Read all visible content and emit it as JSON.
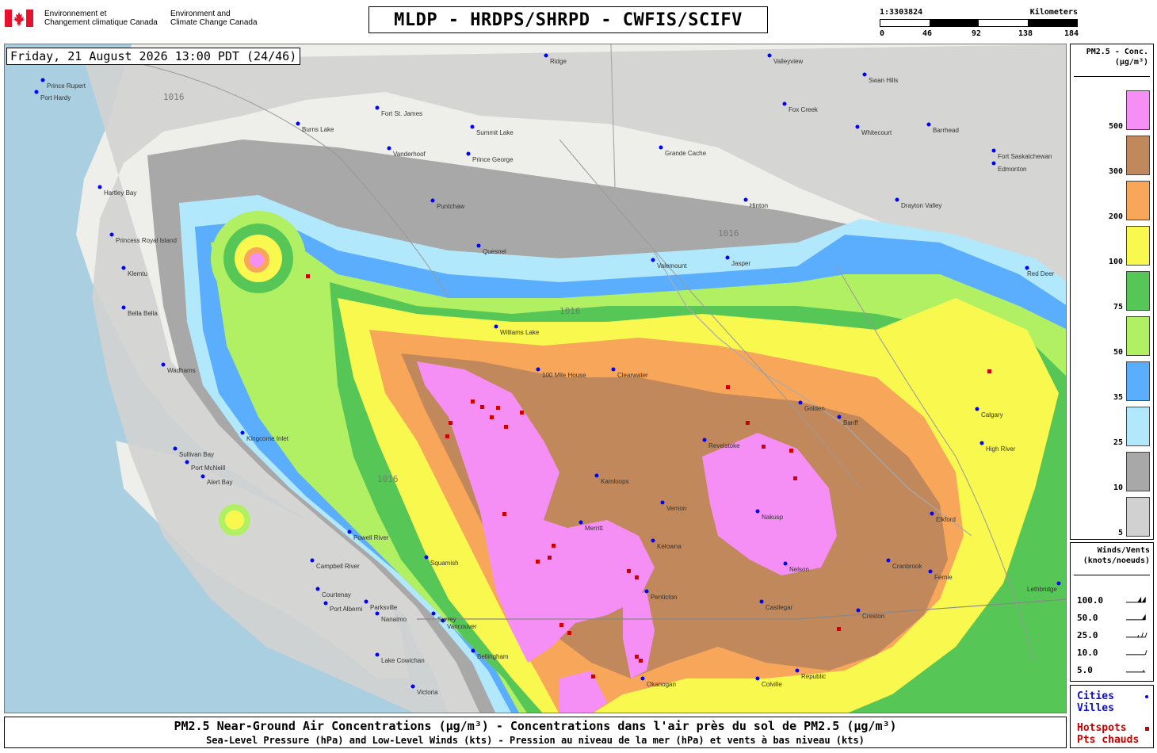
{
  "header": {
    "gov_fr": "Environnement et\nChangement climatique Canada",
    "gov_en": "Environment and\nClimate Change Canada",
    "title": "MLDP - HRDPS/SHRPD - CWFIS/SCIFV",
    "scale_ratio": "1:3303824",
    "scale_unit": "Kilometers",
    "scale_ticks": [
      "0",
      "46",
      "92",
      "138",
      "184"
    ]
  },
  "map": {
    "timestamp": "Friday, 21 August 2026 13:00 PDT (24/46)",
    "isobar_label": "1016",
    "cities": [
      {
        "name": "Ridge"
      },
      {
        "name": "Valleyview"
      },
      {
        "name": "Swan Hills"
      },
      {
        "name": "Fox Creek"
      },
      {
        "name": "Port Hardy"
      },
      {
        "name": "Prince Rupert"
      },
      {
        "name": "Fort St. James"
      },
      {
        "name": "Summit Lake"
      },
      {
        "name": "Burns Lake"
      },
      {
        "name": "Vanderhoof"
      },
      {
        "name": "Prince George"
      },
      {
        "name": "Grande Cache"
      },
      {
        "name": "Whitecourt"
      },
      {
        "name": "Barrhead"
      },
      {
        "name": "Fort Saskatchewan"
      },
      {
        "name": "Edmonton"
      },
      {
        "name": "Hartley Bay"
      },
      {
        "name": "Princess Royal Island"
      },
      {
        "name": "Klemtu"
      },
      {
        "name": "Bella Bella"
      },
      {
        "name": "Puntchaw"
      },
      {
        "name": "Quesnel"
      },
      {
        "name": "Hinton"
      },
      {
        "name": "Drayton Valley"
      },
      {
        "name": "Valemount"
      },
      {
        "name": "Jasper"
      },
      {
        "name": "Williams Lake"
      },
      {
        "name": "100 Mile House"
      },
      {
        "name": "Clearwater"
      },
      {
        "name": "Revelstoke"
      },
      {
        "name": "Golden"
      },
      {
        "name": "Banff"
      },
      {
        "name": "Calgary"
      },
      {
        "name": "High River"
      },
      {
        "name": "Kamloops"
      },
      {
        "name": "Vernon"
      },
      {
        "name": "Kelowna"
      },
      {
        "name": "Penticton"
      },
      {
        "name": "Merritt"
      },
      {
        "name": "Nakusp"
      },
      {
        "name": "Nelson"
      },
      {
        "name": "Castlegar"
      },
      {
        "name": "Cranbrook"
      },
      {
        "name": "Fernie"
      },
      {
        "name": "Elkford"
      },
      {
        "name": "Creston"
      },
      {
        "name": "Port McNeill"
      },
      {
        "name": "Campbell River"
      },
      {
        "name": "Powell River"
      },
      {
        "name": "Courtenay"
      },
      {
        "name": "Squamish"
      },
      {
        "name": "Port Alberni"
      },
      {
        "name": "Parksville"
      },
      {
        "name": "Nanaimo"
      },
      {
        "name": "Vancouver"
      },
      {
        "name": "Surrey"
      },
      {
        "name": "Lake Cowichan"
      },
      {
        "name": "Victoria"
      },
      {
        "name": "Bellingham"
      },
      {
        "name": "Wadhams"
      },
      {
        "name": "Sullivan Bay"
      },
      {
        "name": "Kingcome Inlet"
      },
      {
        "name": "Alert Bay"
      },
      {
        "name": "Red Deer"
      },
      {
        "name": "Lethbridge"
      },
      {
        "name": "Okanogan"
      },
      {
        "name": "Republic"
      },
      {
        "name": "Colville"
      }
    ]
  },
  "legend": {
    "title": "PM2.5 - Conc.\n(µg/m³)",
    "bins": [
      {
        "label": "500",
        "color": "#f58ef5"
      },
      {
        "label": "300",
        "color": "#c1885b"
      },
      {
        "label": "200",
        "color": "#f8a75a"
      },
      {
        "label": "100",
        "color": "#f8f84f"
      },
      {
        "label": "75",
        "color": "#56c756"
      },
      {
        "label": "50",
        "color": "#b1f063"
      },
      {
        "label": "35",
        "color": "#5aaefd"
      },
      {
        "label": "25",
        "color": "#b1e8fb"
      },
      {
        "label": "10",
        "color": "#a8a8a8"
      },
      {
        "label": "5",
        "color": "#d1d1d1"
      }
    ]
  },
  "winds": {
    "title": "Winds/Vents\n(knots/noeuds)",
    "speeds": [
      "100.0",
      "50.0",
      "25.0",
      "10.0",
      "5.0"
    ]
  },
  "key": {
    "cities": "Cities\nVilles",
    "hotspots": "Hotspots\nPts chauds",
    "city_color": "#0000ff",
    "hotspot_color": "#cc0000"
  },
  "caption": {
    "line1": "PM2.5 Near-Ground Air Concentrations (µg/m³) - Concentrations dans l'air près du sol de PM2.5 (µg/m³)",
    "line2": "Sea-Level Pressure (hPa) and Low-Level Winds (kts) - Pression au niveau de la mer (hPa) et vents à bas niveau (kts)"
  }
}
